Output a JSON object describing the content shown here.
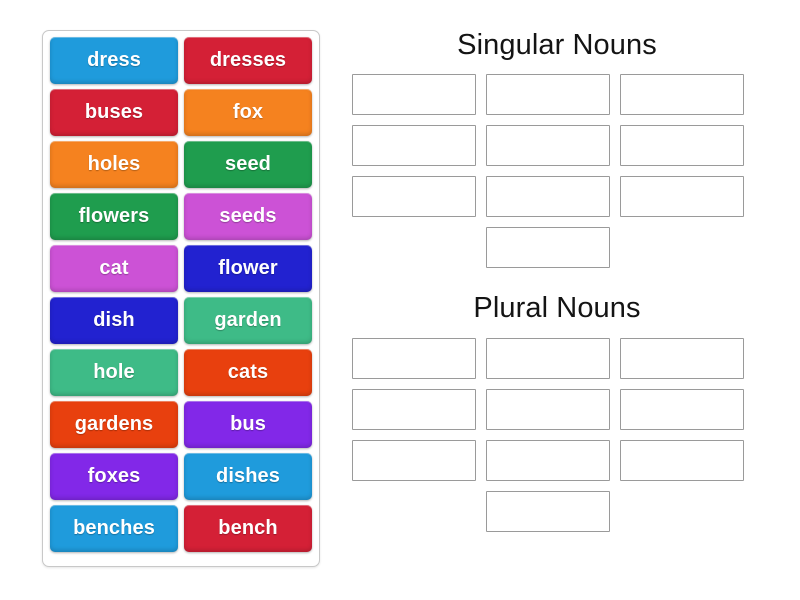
{
  "word_bank": {
    "tiles": [
      {
        "label": "dress",
        "color": "#1f9bdc"
      },
      {
        "label": "dresses",
        "color": "#d42036"
      },
      {
        "label": "buses",
        "color": "#d42036"
      },
      {
        "label": "fox",
        "color": "#f5821f"
      },
      {
        "label": "holes",
        "color": "#f5821f"
      },
      {
        "label": "seed",
        "color": "#1f9d4e"
      },
      {
        "label": "flowers",
        "color": "#1f9d4e"
      },
      {
        "label": "seeds",
        "color": "#cc52d6"
      },
      {
        "label": "cat",
        "color": "#cc52d6"
      },
      {
        "label": "flower",
        "color": "#2222d0"
      },
      {
        "label": "dish",
        "color": "#2222d0"
      },
      {
        "label": "garden",
        "color": "#3ebb87"
      },
      {
        "label": "hole",
        "color": "#3ebb87"
      },
      {
        "label": "cats",
        "color": "#e8400e"
      },
      {
        "label": "gardens",
        "color": "#e8400e"
      },
      {
        "label": "bus",
        "color": "#8228e8"
      },
      {
        "label": "foxes",
        "color": "#8228e8"
      },
      {
        "label": "dishes",
        "color": "#1f9bdc"
      },
      {
        "label": "benches",
        "color": "#1f9bdc"
      },
      {
        "label": "bench",
        "color": "#d42036"
      }
    ]
  },
  "categories": [
    {
      "title": "Singular Nouns",
      "slot_count": 10,
      "slots": [
        "",
        "",
        "",
        "",
        "",
        "",
        "",
        "",
        "",
        ""
      ]
    },
    {
      "title": "Plural Nouns",
      "slot_count": 10,
      "slots": [
        "",
        "",
        "",
        "",
        "",
        "",
        "",
        "",
        "",
        ""
      ]
    }
  ],
  "colors": {
    "background": "#ffffff",
    "panel_border": "#c8c8c8",
    "slot_border": "#9a9a9a",
    "heading_text": "#141414",
    "tile_text": "#ffffff"
  }
}
